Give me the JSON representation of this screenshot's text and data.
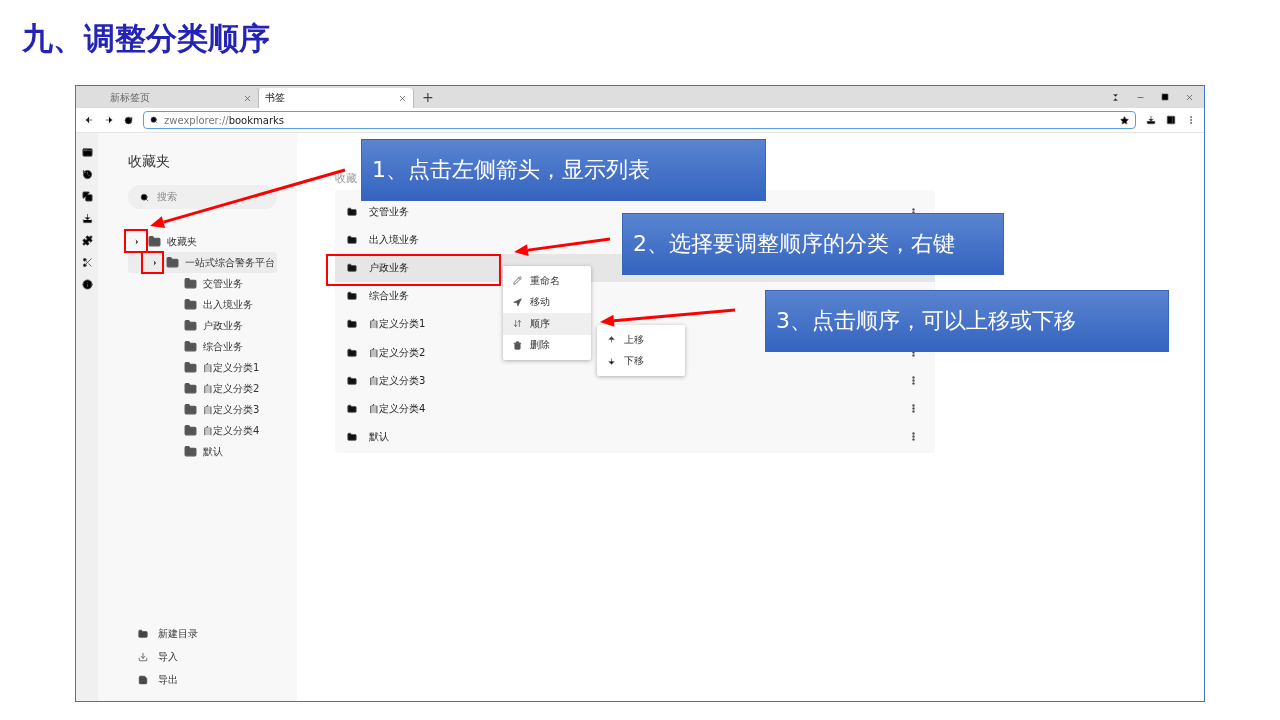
{
  "slide_title": "九、调整分类顺序",
  "browser": {
    "tabs": [
      {
        "label": "新标签页",
        "selected": false
      },
      {
        "label": "书签",
        "selected": true
      }
    ],
    "new_tab": "+",
    "url_scheme": "zwexplorer://",
    "url_path": "bookmarks"
  },
  "sidebar": {
    "title": "收藏夹",
    "search": {
      "placeholder": "搜索"
    },
    "tree": [
      {
        "label": "收藏夹",
        "selected": false,
        "children": [
          {
            "label": "一站式综合警务平台",
            "selected": true,
            "children": [
              {
                "label": "交管业务",
                "selected": false
              },
              {
                "label": "出入境业务",
                "selected": false
              },
              {
                "label": "户政业务",
                "selected": false
              },
              {
                "label": "综合业务",
                "selected": false
              },
              {
                "label": "自定义分类1",
                "selected": false
              },
              {
                "label": "自定义分类2",
                "selected": false
              },
              {
                "label": "自定义分类3",
                "selected": false
              },
              {
                "label": "自定义分类4",
                "selected": false
              },
              {
                "label": "默认",
                "selected": false
              }
            ]
          }
        ]
      }
    ],
    "actions": [
      {
        "kind": "new-folder",
        "label": "新建目录"
      },
      {
        "kind": "import",
        "label": "导入"
      },
      {
        "kind": "export",
        "label": "导出"
      }
    ]
  },
  "main": {
    "heading": "收藏",
    "rows": [
      {
        "label": "交管业务",
        "selected": false
      },
      {
        "label": "出入境业务",
        "selected": false
      },
      {
        "label": "户政业务",
        "selected": true
      },
      {
        "label": "综合业务",
        "selected": false
      },
      {
        "label": "自定义分类1",
        "selected": false
      },
      {
        "label": "自定义分类2",
        "selected": false
      },
      {
        "label": "自定义分类3",
        "selected": false
      },
      {
        "label": "自定义分类4",
        "selected": false
      },
      {
        "label": "默认",
        "selected": false
      }
    ]
  },
  "context_menu": [
    {
      "kind": "rename",
      "label": "重命名",
      "selected": false
    },
    {
      "kind": "move",
      "label": "移动",
      "selected": false
    },
    {
      "kind": "order",
      "label": "顺序",
      "selected": true
    },
    {
      "kind": "delete",
      "label": "删除",
      "selected": false
    }
  ],
  "submenu": [
    {
      "kind": "up",
      "label": "上移"
    },
    {
      "kind": "down",
      "label": "下移"
    }
  ],
  "annotations": [
    "1、点击左侧箭头，显示列表",
    "2、选择要调整顺序的分类，右键",
    "3、点击顺序，可以上移或下移"
  ]
}
